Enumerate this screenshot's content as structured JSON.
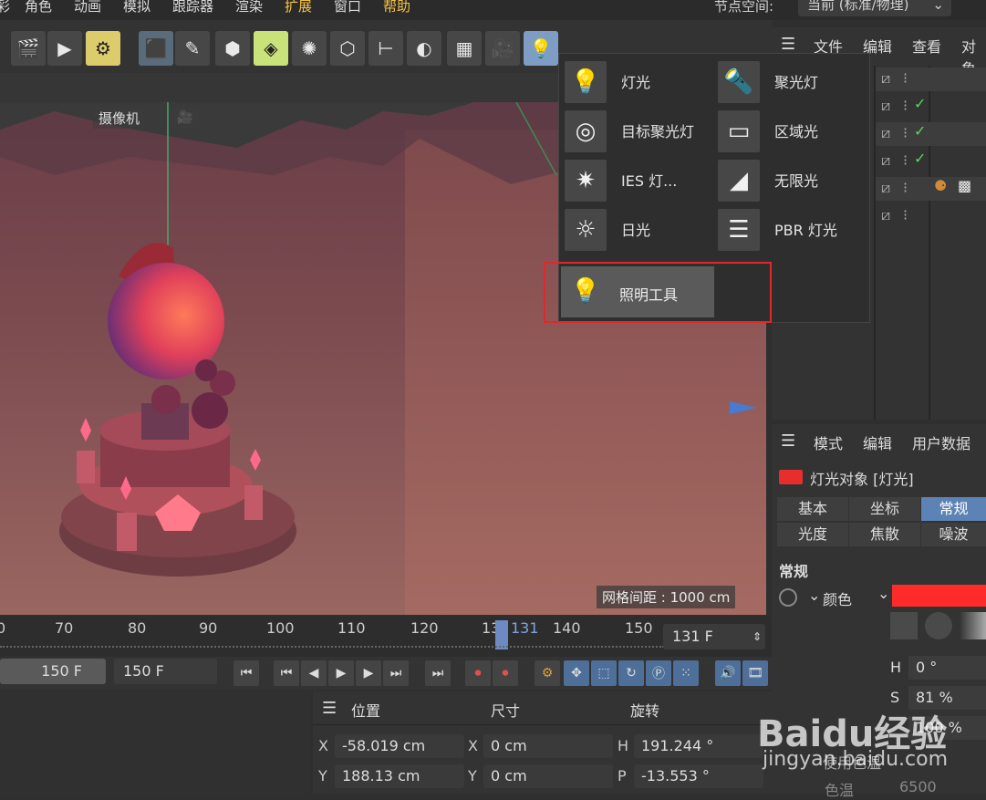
{
  "menu": {
    "items": [
      "彩",
      "角色",
      "动画",
      "模拟",
      "跟踪器",
      "渲染",
      "扩展",
      "窗口",
      "帮助"
    ],
    "node_space_label": "节点空间:",
    "node_space_value": "当前 (标准/物理)"
  },
  "viewport": {
    "camera_label": "摄像机",
    "grid_distance": "网格间距 : 1000 cm"
  },
  "light_menu": {
    "items": [
      {
        "label": "灯光",
        "icon": "light-bulb-icon"
      },
      {
        "label": "聚光灯",
        "icon": "spotlight-icon"
      },
      {
        "label": "目标聚光灯",
        "icon": "target-spotlight-icon"
      },
      {
        "label": "区域光",
        "icon": "area-light-icon"
      },
      {
        "label": "IES 灯...",
        "icon": "ies-light-icon"
      },
      {
        "label": "无限光",
        "icon": "infinite-light-icon"
      },
      {
        "label": "日光",
        "icon": "sun-icon"
      },
      {
        "label": "PBR 灯光",
        "icon": "pbr-light-icon"
      }
    ],
    "lighting_tool": "照明工具"
  },
  "timeline": {
    "ticks": [
      "0",
      "70",
      "80",
      "90",
      "100",
      "110",
      "120",
      "13",
      "131",
      "140",
      "150"
    ],
    "current_frame": "131 F"
  },
  "transport": {
    "start_field": "150 F",
    "end_field": "150 F"
  },
  "coords": {
    "headers": {
      "position": "位置",
      "size": "尺寸",
      "rotation": "旋转"
    },
    "rows": [
      {
        "axis": "X",
        "position": "-58.019 cm",
        "size_axis": "X",
        "size": "0 cm",
        "rot_axis": "H",
        "rotation": "191.244 °"
      },
      {
        "axis": "Y",
        "position": "188.13 cm",
        "size_axis": "Y",
        "size": "0 cm",
        "rot_axis": "P",
        "rotation": "-13.553 °"
      }
    ]
  },
  "object_manager": {
    "menu": [
      "文件",
      "编辑",
      "查看",
      "对象"
    ]
  },
  "attribute_manager": {
    "menu": [
      "模式",
      "编辑",
      "用户数据"
    ],
    "object_title": "灯光对象 [灯光]",
    "tabs_row1": [
      "基本",
      "坐标",
      "常规"
    ],
    "tabs_row2": [
      "光度",
      "焦散",
      "噪波"
    ],
    "section": "常规",
    "color_label": "颜色",
    "color_value": "#ff2a2a",
    "h_label": "H",
    "h_value": "0 °",
    "s_label": "S",
    "s_value": "81 %",
    "v_value": "100 %",
    "use_temp_label": "使用色温",
    "temp_label": "色温",
    "temp_value": "6500"
  },
  "watermark": {
    "brand": "Baidu经验",
    "url": "jingyan.baidu.com"
  }
}
